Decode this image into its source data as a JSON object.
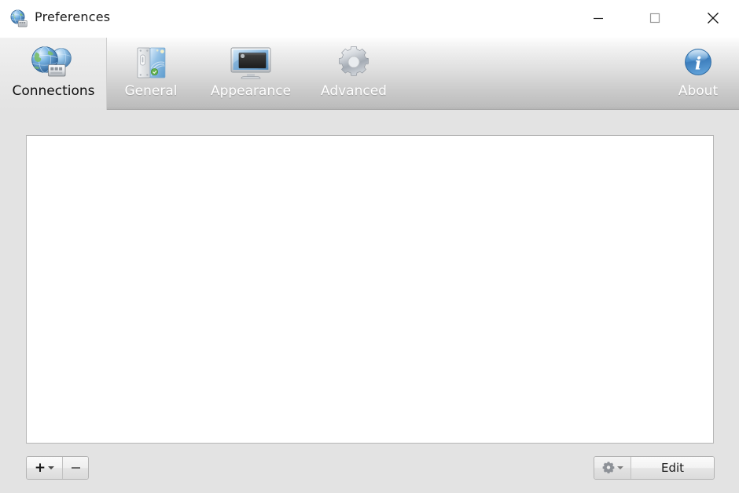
{
  "window": {
    "title": "Preferences",
    "title_icon": "globe-server-icon",
    "background_color": "#e3e3e3",
    "controls": [
      {
        "name": "minimize",
        "glyph": "—"
      },
      {
        "name": "maximize",
        "glyph": "□"
      },
      {
        "name": "close",
        "glyph": "✕"
      }
    ]
  },
  "toolbar": {
    "tabs": [
      {
        "id": "connections",
        "label": "Connections",
        "icon": "network-globes-icon",
        "selected": true
      },
      {
        "id": "general",
        "label": "General",
        "icon": "computer-tower-icon",
        "selected": false
      },
      {
        "id": "appearance",
        "label": "Appearance",
        "icon": "monitor-icon",
        "selected": false
      },
      {
        "id": "advanced",
        "label": "Advanced",
        "icon": "gear-icon",
        "selected": false
      }
    ],
    "about": {
      "id": "about",
      "label": "About",
      "icon": "info-circle-icon"
    }
  },
  "main": {
    "list": {
      "name": "connections-list",
      "items": [],
      "empty": true
    }
  },
  "footer": {
    "add_button": {
      "label": "+",
      "has_menu": true,
      "enabled": true
    },
    "remove_button": {
      "label": "−",
      "has_menu": false,
      "enabled": false
    },
    "gear_button": {
      "label": "",
      "icon": "gear-icon",
      "has_menu": true,
      "enabled": false
    },
    "edit_button": {
      "label": "Edit",
      "enabled": true
    }
  },
  "colors": {
    "accent_blue": "#3d7fc1",
    "window_bg": "#e3e3e3",
    "toolbar_top": "#fdfdfd",
    "toolbar_bottom": "#b4b4b4",
    "list_bg": "#ffffff"
  }
}
